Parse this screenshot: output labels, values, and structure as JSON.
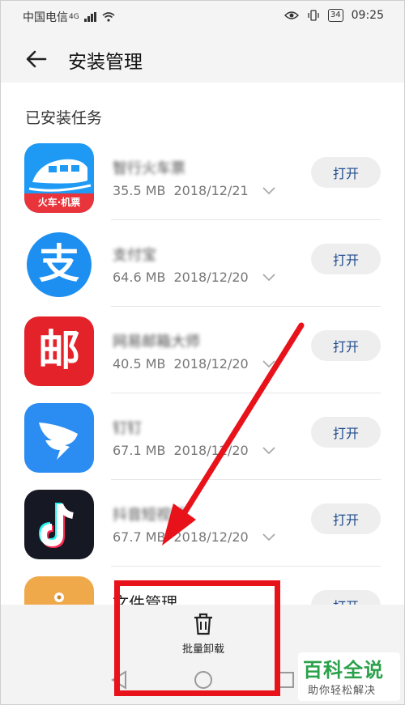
{
  "status_bar": {
    "carrier": "中国电信",
    "network": "4G",
    "battery": "34",
    "time": "09:25"
  },
  "header": {
    "title": "安装管理"
  },
  "section": {
    "title": "已安装任务"
  },
  "apps": [
    {
      "name": "智行火车票",
      "size": "35.5 MB",
      "date": "2018/12/21",
      "action": "打开",
      "icon_label": "火车·机票"
    },
    {
      "name": "支付宝",
      "size": "64.6 MB",
      "date": "2018/12/20",
      "action": "打开",
      "icon_glyph": "支"
    },
    {
      "name": "网易邮箱大师",
      "size": "40.5 MB",
      "date": "2018/12/20",
      "action": "打开",
      "icon_glyph": "邮"
    },
    {
      "name": "钉钉",
      "size": "67.1 MB",
      "date": "2018/12/20",
      "action": "打开"
    },
    {
      "name": "抖音短视频",
      "size": "67.7 MB",
      "date": "2018/12/20",
      "action": "打开"
    },
    {
      "name": "文件管理",
      "size": "",
      "date": "",
      "action": "打开"
    }
  ],
  "bottom_bar": {
    "batch_uninstall_label": "批量卸载"
  },
  "watermark": {
    "title": "百科全说",
    "subtitle": "助你轻松解决"
  },
  "colors": {
    "accent": "#1f4b8e",
    "highlight": "#e8121a",
    "watermark": "#2aa14a"
  }
}
